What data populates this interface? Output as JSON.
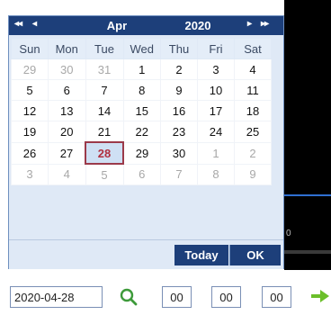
{
  "calendar": {
    "nav": {
      "prev_year": "◂◂",
      "prev_month": "◂",
      "next_month": "▸",
      "next_year": "▸▸"
    },
    "month": "Apr",
    "year": "2020",
    "weekdays": [
      "Sun",
      "Mon",
      "Tue",
      "Wed",
      "Thu",
      "Fri",
      "Sat"
    ],
    "weeks": [
      [
        "29",
        "30",
        "31",
        "1",
        "2",
        "3",
        "4"
      ],
      [
        "5",
        "6",
        "7",
        "8",
        "9",
        "10",
        "11"
      ],
      [
        "12",
        "13",
        "14",
        "15",
        "16",
        "17",
        "18"
      ],
      [
        "19",
        "20",
        "21",
        "22",
        "23",
        "24",
        "25"
      ],
      [
        "26",
        "27",
        "28",
        "29",
        "30",
        "1",
        "2"
      ],
      [
        "3",
        "4",
        "5",
        "6",
        "7",
        "8",
        "9"
      ]
    ],
    "today_label": "Today",
    "ok_label": "OK"
  },
  "form": {
    "date_value": "2020-04-28",
    "hour": "00",
    "minute": "00",
    "second": "00"
  },
  "background": {
    "zero_label": "0"
  }
}
